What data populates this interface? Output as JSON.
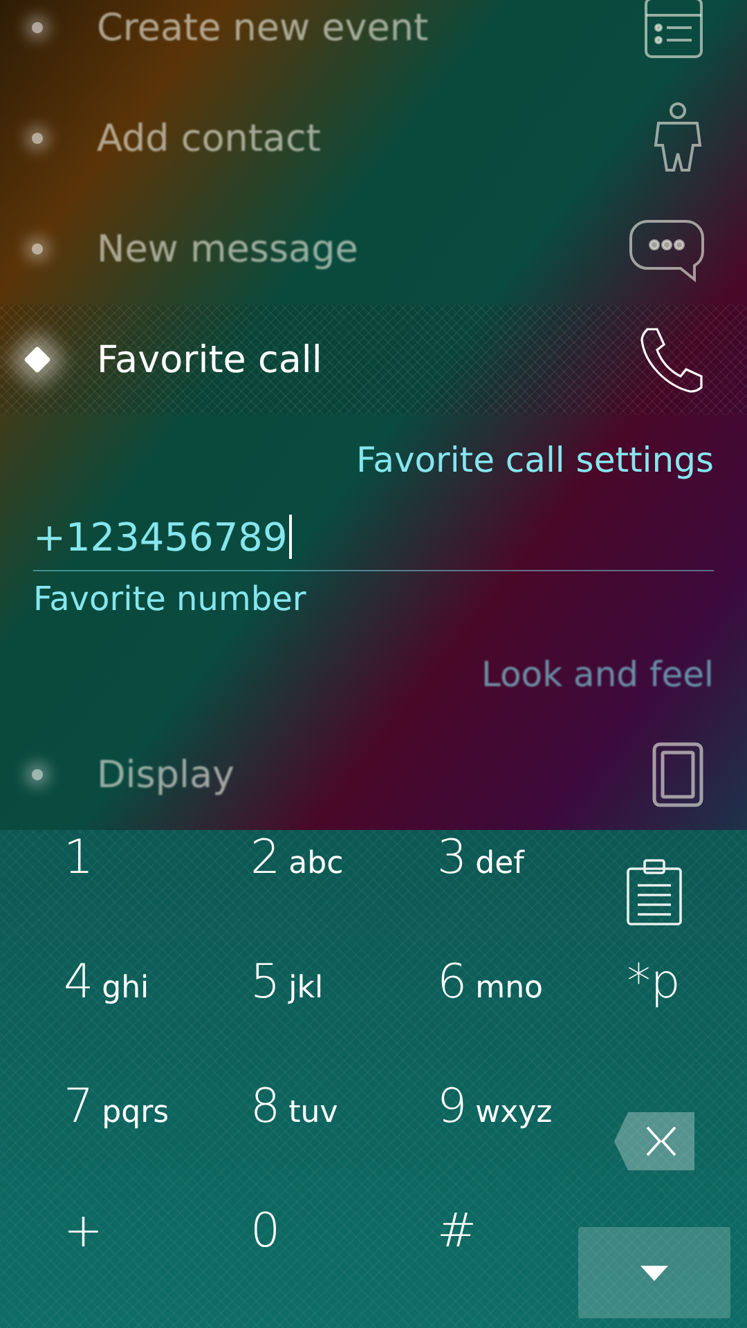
{
  "menu_items": [
    {
      "kind": "event",
      "label": "Create new event",
      "selected": false
    },
    {
      "kind": "contact",
      "label": "Add contact",
      "selected": false
    },
    {
      "kind": "message",
      "label": "New message",
      "selected": false
    },
    {
      "kind": "call",
      "label": "Favorite call",
      "selected": true
    }
  ],
  "settings_link": "Favorite call settings",
  "number_field": {
    "value": "+123456789",
    "label": "Favorite number"
  },
  "section_header": "Look and feel",
  "lower_items": [
    {
      "kind": "display",
      "label": "Display",
      "selected": false
    }
  ],
  "keypad": {
    "keys": [
      {
        "kind": "digit",
        "digit": "1"
      },
      {
        "kind": "digit",
        "digit": "2",
        "letters": "abc"
      },
      {
        "kind": "digit",
        "digit": "3",
        "letters": "def"
      },
      {
        "kind": "paste"
      },
      {
        "kind": "digit",
        "digit": "4",
        "letters": "ghi"
      },
      {
        "kind": "digit",
        "digit": "5",
        "letters": "jkl"
      },
      {
        "kind": "digit",
        "digit": "6",
        "letters": "mno"
      },
      {
        "kind": "digit",
        "digit": "*p"
      },
      {
        "kind": "digit",
        "digit": "7",
        "letters": "pqrs"
      },
      {
        "kind": "digit",
        "digit": "8",
        "letters": "tuv"
      },
      {
        "kind": "digit",
        "digit": "9",
        "letters": "wxyz"
      },
      {
        "kind": "backspace"
      },
      {
        "kind": "digit",
        "digit": "+"
      },
      {
        "kind": "digit",
        "digit": "0"
      },
      {
        "kind": "digit",
        "digit": "#"
      },
      {
        "kind": "hide"
      }
    ]
  }
}
